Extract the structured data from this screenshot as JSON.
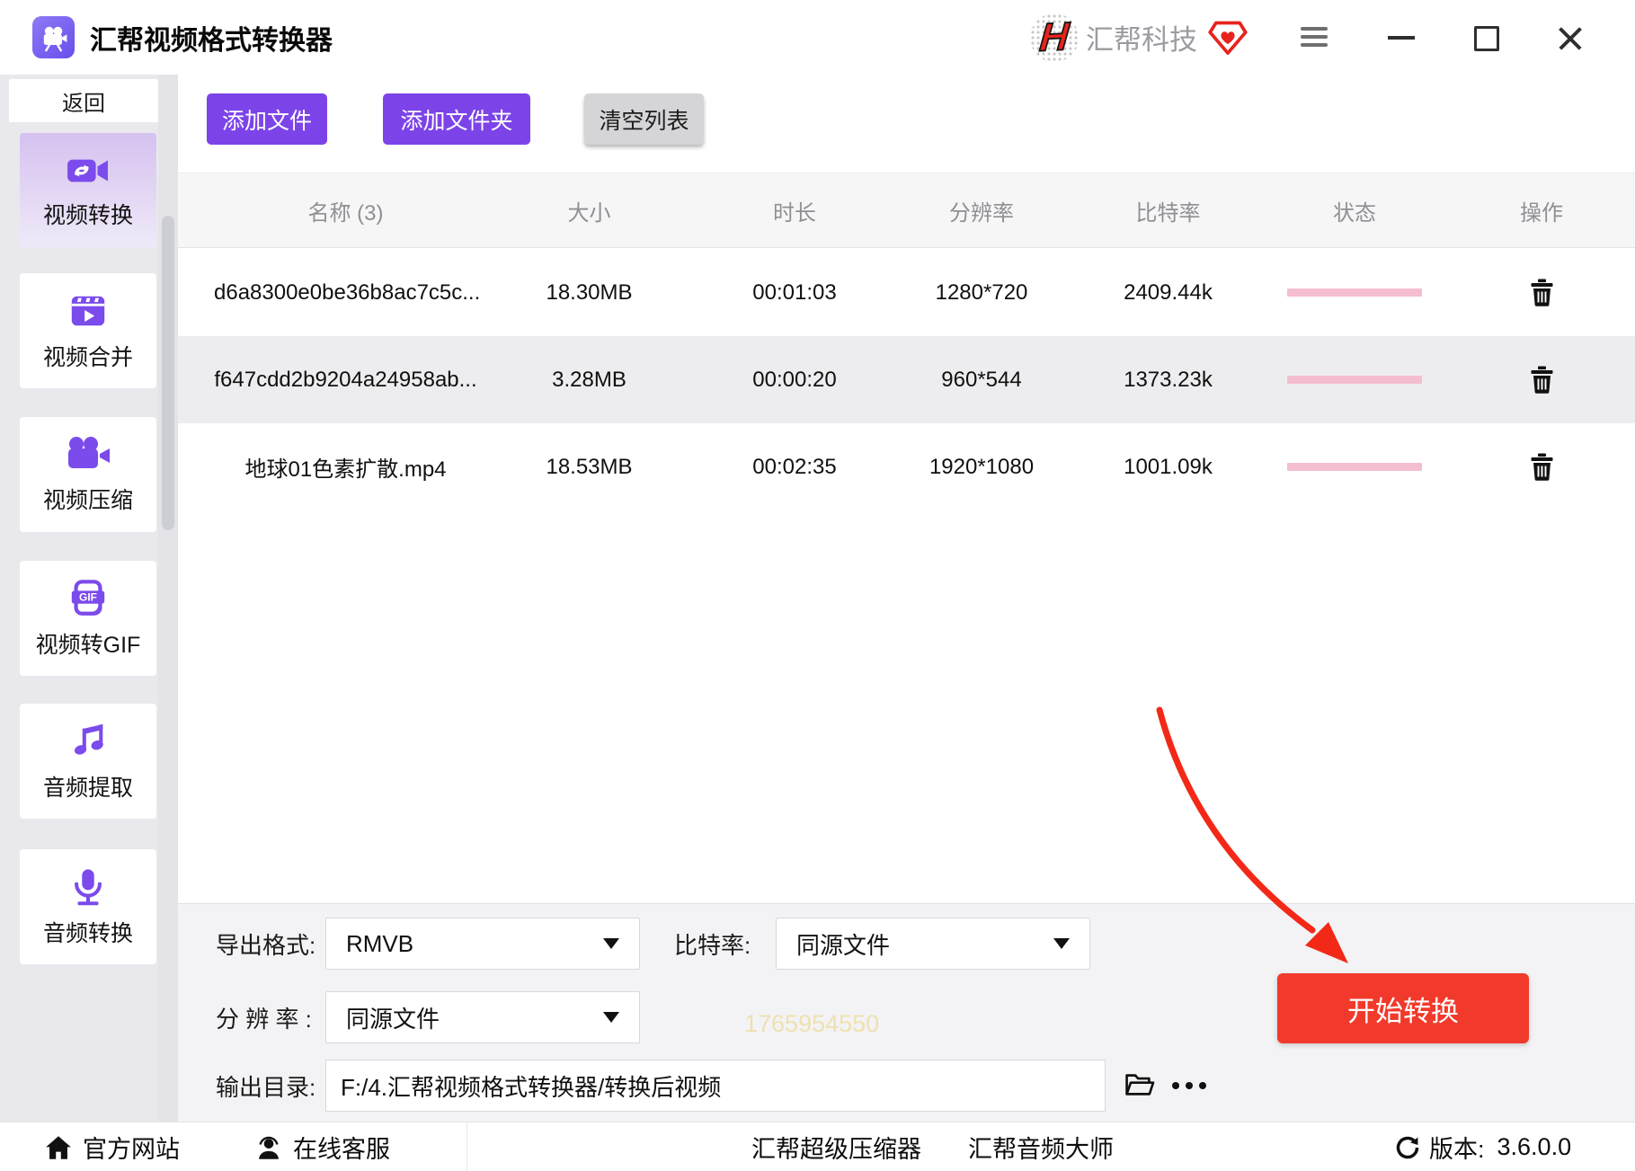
{
  "window": {
    "title": "汇帮视频格式转换器",
    "brand_initial": "H",
    "brand_name": "汇帮科技"
  },
  "sidebar": {
    "back": "返回",
    "items": [
      {
        "label": "视频转换",
        "icon": "video-convert-icon",
        "active": true
      },
      {
        "label": "视频合并",
        "icon": "video-merge-icon",
        "active": false
      },
      {
        "label": "视频压缩",
        "icon": "video-compress-icon",
        "active": false
      },
      {
        "label": "视频转GIF",
        "icon": "video-to-gif-icon",
        "icon_text": "GIF",
        "active": false
      },
      {
        "label": "音频提取",
        "icon": "audio-extract-icon",
        "active": false
      },
      {
        "label": "音频转换",
        "icon": "audio-convert-icon",
        "active": false
      }
    ]
  },
  "toolbar": {
    "add_file": "添加文件",
    "add_folder": "添加文件夹",
    "clear_list": "清空列表"
  },
  "table": {
    "headers": [
      "名称 (3)",
      "大小",
      "时长",
      "分辨率",
      "比特率",
      "状态",
      "操作"
    ],
    "rows": [
      {
        "name": "d6a8300e0be36b8ac7c5c...",
        "size": "18.30MB",
        "duration": "00:01:03",
        "resolution": "1280*720",
        "bitrate": "2409.44k",
        "progress": 0
      },
      {
        "name": "f647cdd2b9204a24958ab...",
        "size": "3.28MB",
        "duration": "00:00:20",
        "resolution": "960*544",
        "bitrate": "1373.23k",
        "progress": 0
      },
      {
        "name": "地球01色素扩散.mp4",
        "size": "18.53MB",
        "duration": "00:02:35",
        "resolution": "1920*1080",
        "bitrate": "1001.09k",
        "progress": 0
      }
    ]
  },
  "settings": {
    "export_format_label": "导出格式:",
    "export_format_value": "RMVB",
    "bitrate_label": "比特率:",
    "bitrate_value": "同源文件",
    "resolution_label": "分 辨 率 :",
    "resolution_value": "同源文件",
    "output_dir_label": "输出目录:",
    "output_dir_value": "F:/4.汇帮视频格式转换器/转换后视频",
    "start_button": "开始转换",
    "watermark": "1765954550"
  },
  "status_bar": {
    "official_site": "官方网站",
    "online_service": "在线客服",
    "super_compressor": "汇帮超级压缩器",
    "audio_master": "汇帮音频大师",
    "version_label": "版本:",
    "version_value": "3.6.0.0"
  },
  "colors": {
    "accent_purple": "#7c44e8",
    "icon_purple": "#7b4beb",
    "active_card_top": "#d5c1ef",
    "start_red": "#f13a2b",
    "arrow_red": "#f32918",
    "progress_pink": "#f5bdd0",
    "brand_red": "#e8231c",
    "sidebar_bg": "#e9e9ed",
    "panel_bg": "#f3f3f5",
    "row_alt": "#ededef",
    "header_text": "#8f8f94"
  },
  "icons": {
    "app": "movie-camera",
    "vip": "gem-heart",
    "menu": "hamburger",
    "delete": "trash",
    "folder": "open-folder",
    "more": "ellipsis-dots",
    "home": "house",
    "service": "person-bust",
    "version": "refresh-arrow",
    "dropdown": "caret-down"
  }
}
